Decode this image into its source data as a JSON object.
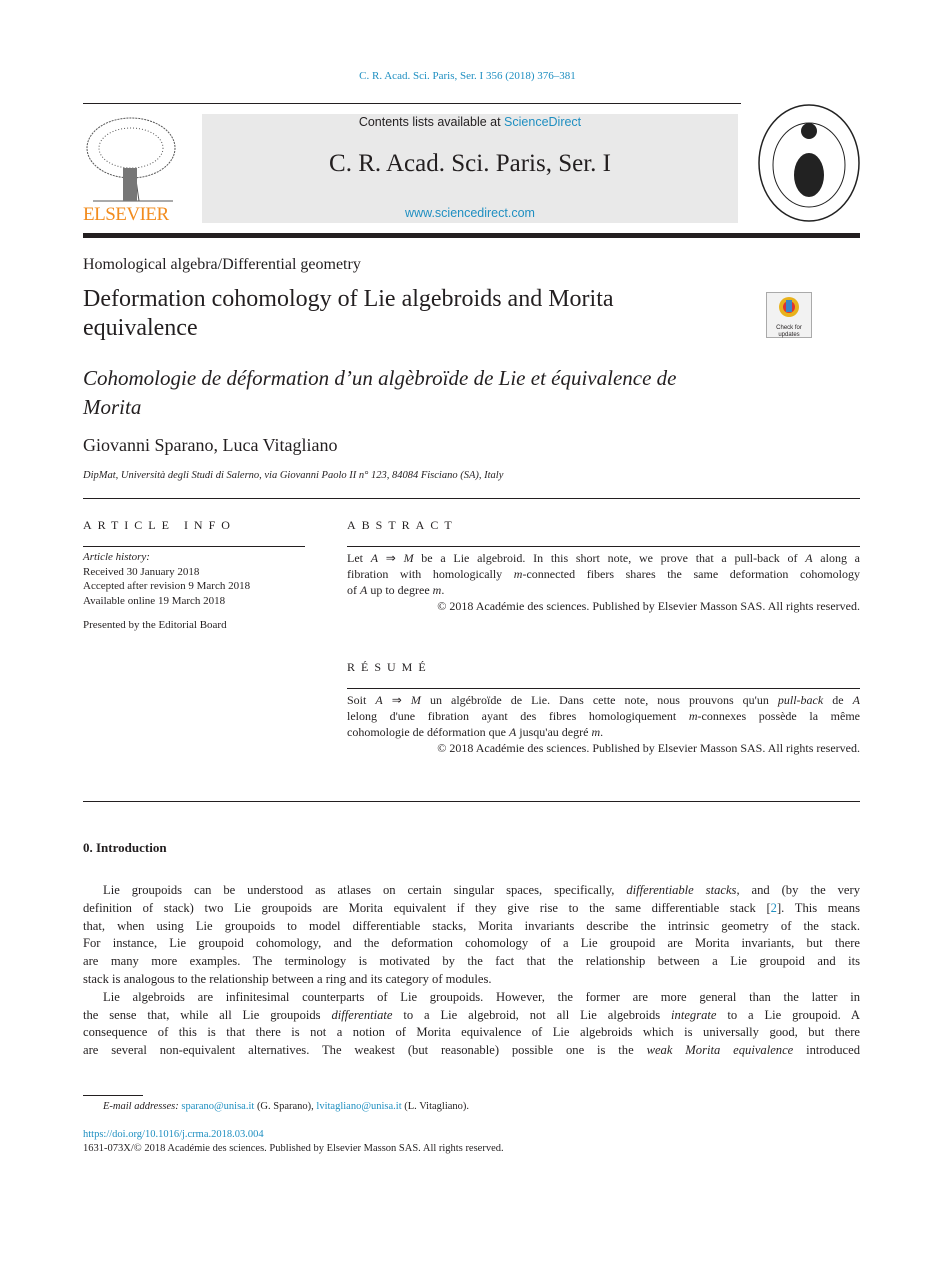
{
  "citation": "C. R. Acad. Sci. Paris, Ser. I 356 (2018) 376–381",
  "masthead": {
    "contents_prefix": "Contents lists available at ",
    "contents_link": "ScienceDirect",
    "journal": "C. R. Acad. Sci. Paris, Ser. I",
    "url": "www.sciencedirect.com",
    "publisher_logo": "ELSEVIER",
    "seal_text": "INSTITUT DE FRANCE ACADÉMIE DES SCIENCES 1666"
  },
  "colors": {
    "link": "#1f8fc1",
    "elsevier": "#f28c1e",
    "masthead_bg": "#e9e9e9"
  },
  "section": "Homological algebra/Differential geometry",
  "title_lines": [
    "Deformation cohomology of Lie algebroids and Morita",
    "equivalence"
  ],
  "check_updates": "Check for updates",
  "french_title_lines": [
    "Cohomologie de déformation d’un algèbroïde de Lie et équivalence de",
    "Morita"
  ],
  "authors": "Giovanni Sparano, Luca Vitagliano",
  "affiliation": "DipMat, Università degli Studi di Salerno, via Giovanni Paolo II n° 123, 84084 Fisciano (SA), Italy",
  "article_info": {
    "heading": "ARTICLE INFO",
    "history_label": "Article history:",
    "received": "Received 30 January 2018",
    "accepted": "Accepted after revision 9 March 2018",
    "online": "Available online 19 March 2018",
    "presented": "Presented by the Editorial Board"
  },
  "abstract": {
    "heading": "ABSTRACT",
    "lines": [
      [
        "Let ",
        {
          "i": "A"
        },
        " ⇒ ",
        {
          "i": "M"
        },
        " be a Lie algebroid. In this short note, we prove that a pull-back of ",
        {
          "i": "A"
        },
        " along a"
      ],
      [
        "fibration with homologically ",
        {
          "i": "m"
        },
        "-connected fibers shares the same deformation cohomology"
      ],
      [
        "of ",
        {
          "i": "A"
        },
        " up to degree ",
        {
          "i": "m"
        },
        "."
      ]
    ],
    "copyright": "© 2018 Académie des sciences. Published by Elsevier Masson SAS. All rights reserved."
  },
  "resume": {
    "heading": "RÉSUMÉ",
    "lines": [
      [
        "Soit ",
        {
          "i": "A"
        },
        " ⇒ ",
        {
          "i": "M"
        },
        " un algébroïde de Lie. Dans cette note, nous prouvons qu'un ",
        {
          "i": "pull-back"
        },
        " de ",
        {
          "i": "A"
        }
      ],
      [
        "lelong d'une fibration ayant des fibres homologiquement ",
        {
          "i": "m"
        },
        "-connexes possède la même"
      ],
      [
        "cohomologie de déformation que ",
        {
          "i": "A"
        },
        " jusqu'au degré ",
        {
          "i": "m"
        },
        "."
      ]
    ],
    "copyright": "© 2018 Académie des sciences. Published by Elsevier Masson SAS. All rights reserved."
  },
  "intro": {
    "heading": "0.  Introduction",
    "paragraphs": [
      [
        [
          "Lie groupoids can be understood as atlases on certain singular spaces, specifically, ",
          {
            "i": "differentiable stacks"
          },
          ", and (by the very"
        ],
        [
          "definition of stack) two Lie groupoids are Morita equivalent if they give rise to the same differentiable stack [",
          {
            "link": "2"
          },
          "]. This means"
        ],
        [
          "that, when using Lie groupoids to model differentiable stacks, Morita invariants describe the intrinsic geometry of the stack."
        ],
        [
          "For instance, Lie groupoid cohomology, and the deformation cohomology of a Lie groupoid are Morita invariants, but there"
        ],
        [
          "are many more examples. The terminology is motivated by the fact that the relationship between a Lie groupoid and its"
        ],
        [
          "stack is analogous to the relationship between a ring and its category of modules."
        ]
      ],
      [
        [
          "Lie algebroids are infinitesimal counterparts of Lie groupoids. However, the former are more general than the latter in"
        ],
        [
          "the sense that, while all Lie groupoids ",
          {
            "i": "differentiate"
          },
          " to a Lie algebroid, not all Lie algebroids ",
          {
            "i": "integrate"
          },
          " to a Lie groupoid. A"
        ],
        [
          "consequence of this is that there is not a notion of Morita equivalence of Lie algebroids which is universally good, but there"
        ],
        [
          "are several non-equivalent alternatives. The weakest (but reasonable) possible one is the ",
          {
            "i": "weak Morita equivalence"
          },
          " introduced"
        ]
      ]
    ]
  },
  "footnote": {
    "label": "E-mail addresses:",
    "email1": "sparano@unisa.it",
    "name1": " (G. Sparano), ",
    "email2": "lvitagliano@unisa.it",
    "name2": " (L. Vitagliano).",
    "doi": "https://doi.org/10.1016/j.crma.2018.03.004",
    "rights": "1631-073X/© 2018 Académie des sciences. Published by Elsevier Masson SAS. All rights reserved."
  }
}
